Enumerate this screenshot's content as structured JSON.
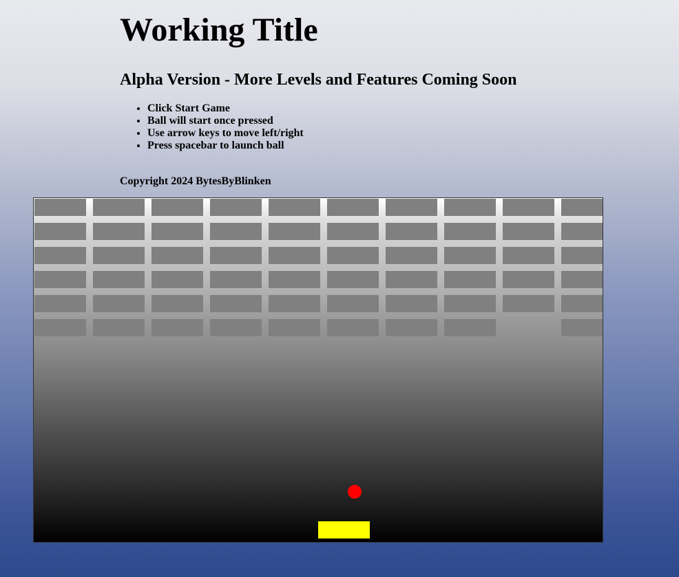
{
  "page": {
    "title": "Working Title",
    "subtitle": "Alpha Version - More Levels and Features Coming Soon",
    "instructions": [
      "Click Start Game",
      "Ball will start once pressed",
      "Use arrow keys to move left/right",
      "Press spacebar to launch ball"
    ],
    "copyright": "Copyright 2024 BytesByBlinken"
  },
  "game": {
    "colors": {
      "brick": "#808080",
      "ball": "#ff0000",
      "paddle": "#ffff00"
    },
    "brick_grid": {
      "rows": 6,
      "columns": 10,
      "missing_bricks": [
        [
          5,
          8
        ]
      ]
    }
  }
}
